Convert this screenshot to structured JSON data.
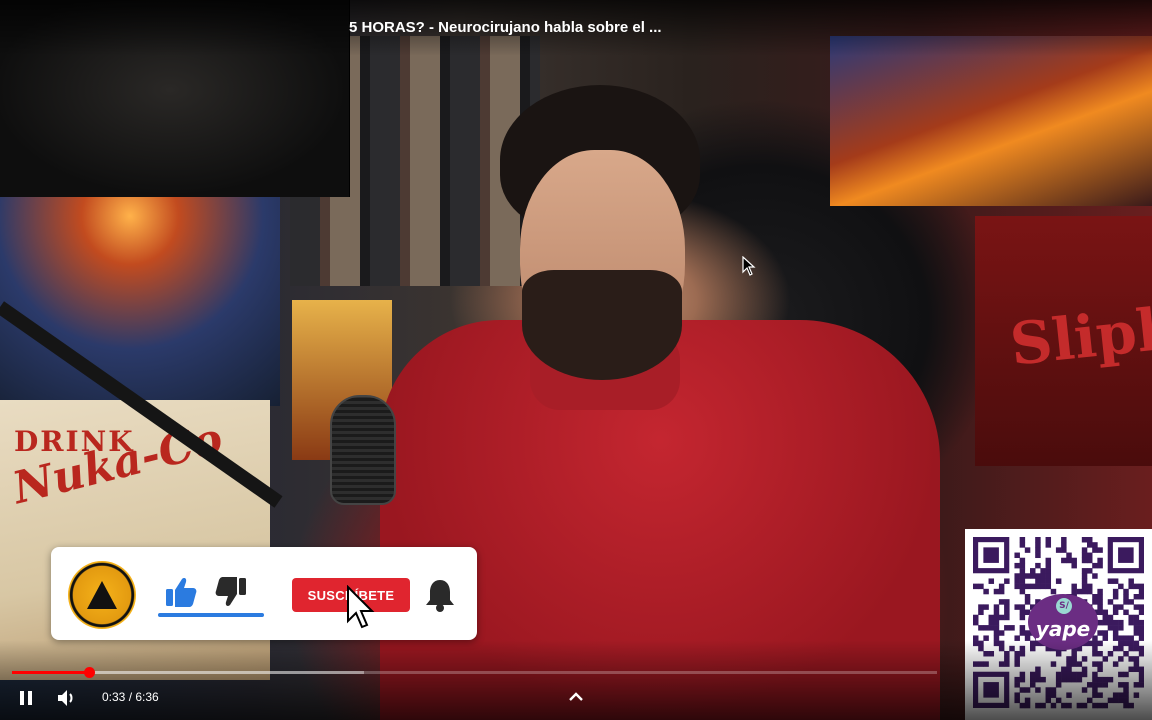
{
  "video": {
    "title": "5 HORAS? - Neurocirujano habla sobre el ...",
    "background_text": {
      "poster_nuka_line1": "DRINK",
      "poster_nuka_line2": "Nuka-Co",
      "poster_band": "Slipkn"
    }
  },
  "subscribe_card": {
    "logo_icon": "the-wild-project-logo",
    "like_icon": "thumbs-up-icon",
    "dislike_icon": "thumbs-down-icon",
    "subscribe_label": "SUSCRÍBETE",
    "bell_icon": "bell-icon",
    "like_bar_color": "#2b7be0",
    "button_color": "#e0252f"
  },
  "qr_overlay": {
    "brand": "yape",
    "badge": "S/",
    "brand_color": "#6b2d83"
  },
  "controls": {
    "time": "0:33 / 6:36",
    "played_fraction": 0.083,
    "buffered_fraction": 0.38,
    "progress_color": "#ff0000",
    "pause_icon": "pause-icon",
    "volume_icon": "volume-icon",
    "expand_icon": "chevron-up-icon"
  }
}
